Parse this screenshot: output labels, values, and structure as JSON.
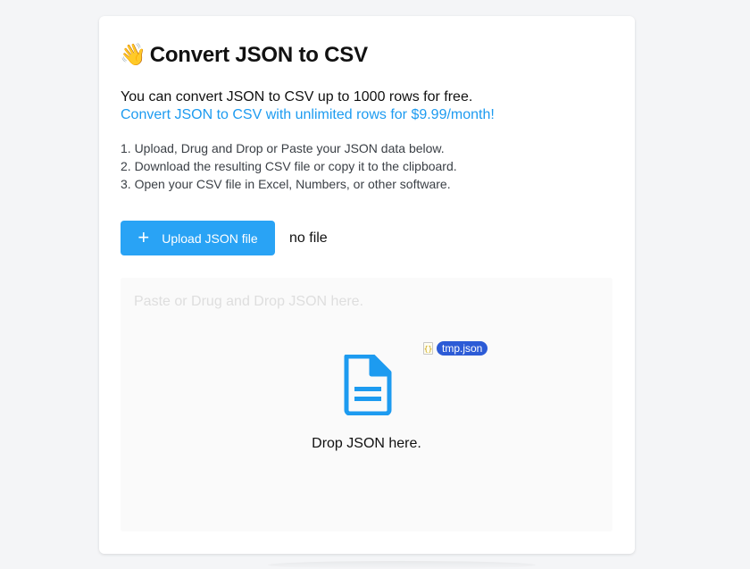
{
  "header": {
    "emoji": "👋",
    "title": "Convert JSON to CSV"
  },
  "intro": {
    "free_text": "You can convert JSON to CSV up to 1000 rows for free.",
    "upgrade_link": "Convert JSON to CSV with unlimited rows for $9.99/month!"
  },
  "steps": [
    "1. Upload, Drug and Drop or Paste your JSON data below.",
    "2. Download the resulting CSV file or copy it to the clipboard.",
    "3. Open your CSV file in Excel, Numbers, or other software."
  ],
  "upload": {
    "button_label": "Upload JSON file",
    "file_status": "no file"
  },
  "dropzone": {
    "placeholder": "Paste or Drug and Drop JSON here.",
    "drop_label": "Drop JSON here.",
    "dragged_file": "tmp.json"
  },
  "colors": {
    "accent": "#29a3f5",
    "link": "#1d9bf0",
    "drag_chip": "#2c5bd6"
  },
  "icons": {
    "upload": "plus-icon",
    "drop": "document-icon",
    "dragged": "json-file-icon"
  }
}
